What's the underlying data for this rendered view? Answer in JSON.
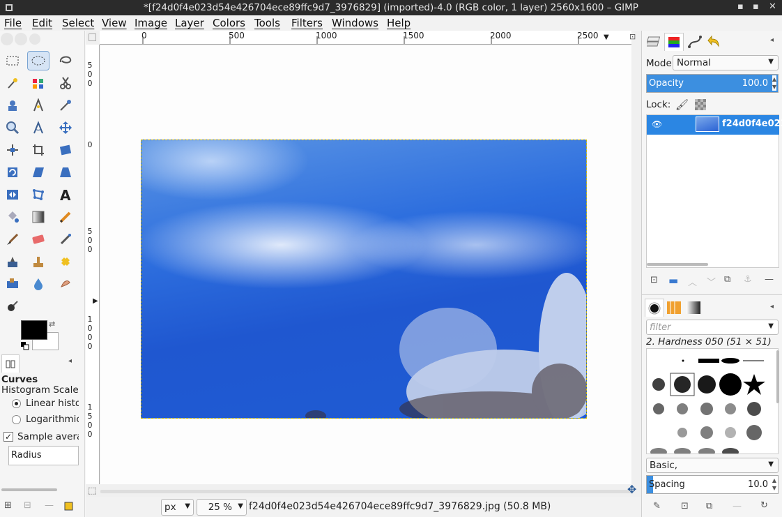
{
  "window": {
    "title": "*[f24d0f4e023d54e426704ece89ffc9d7_3976829] (imported)-4.0 (RGB color, 1 layer) 2560x1600 – GIMP",
    "min": "▪",
    "max": "▪",
    "close": "✕"
  },
  "menu": [
    "File",
    "Edit",
    "Select",
    "View",
    "Image",
    "Layer",
    "Colors",
    "Tools",
    "Filters",
    "Windows",
    "Help"
  ],
  "rulers": {
    "top": [
      "0",
      "500",
      "1000",
      "1500",
      "2000",
      "2500"
    ],
    "left": [
      [
        "5",
        "0",
        "0"
      ],
      [
        "0"
      ],
      [
        "5",
        "0",
        "0"
      ],
      [
        "1",
        "0",
        "0",
        "0"
      ],
      [
        "1",
        "5",
        "0",
        "0"
      ]
    ]
  },
  "tool_options": {
    "title": "Curves",
    "subtitle": "Histogram Scale",
    "opt_linear": "Linear histog",
    "opt_log": "Logarithmic h",
    "sample_average": "Sample averag",
    "radius": "Radius"
  },
  "statusbar": {
    "unit": "px",
    "zoom": "25 %",
    "info": "f24d0f4e023d54e426704ece89ffc9d7_3976829.jpg (50.8 MB)"
  },
  "layers": {
    "mode_label": "Mode:",
    "mode_value": "Normal",
    "opacity_label": "Opacity",
    "opacity_value": "100.0",
    "opacity_fraction": 1.0,
    "lock_label": "Lock:",
    "layer_name": "f24d0f4e023d"
  },
  "brushes": {
    "filter_placeholder": "filter",
    "selected": "2. Hardness 050 (51 × 51)",
    "preset": "Basic,",
    "spacing_label": "Spacing",
    "spacing_value": "10.0",
    "spacing_fraction": 0.05
  },
  "colors": {
    "accent": "#3c8fe0",
    "selection": "#2b86e3",
    "titlebar": "#2b2b2b"
  }
}
